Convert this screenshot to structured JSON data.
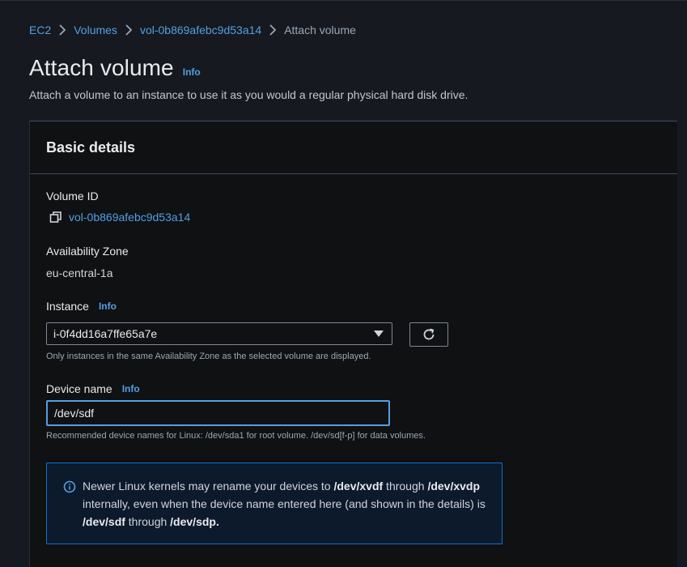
{
  "breadcrumb": {
    "items": [
      "EC2",
      "Volumes",
      "vol-0b869afebc9d53a14"
    ],
    "current": "Attach volume"
  },
  "header": {
    "title": "Attach volume",
    "info": "Info",
    "description": "Attach a volume to an instance to use it as you would a regular physical hard disk drive."
  },
  "basic_details": {
    "title": "Basic details",
    "volume_id_label": "Volume ID",
    "volume_id": "vol-0b869afebc9d53a14",
    "az_label": "Availability Zone",
    "az_value": "eu-central-1a",
    "instance_label": "Instance",
    "instance_info": "Info",
    "instance_value": "i-0f4dd16a7ffe65a7e",
    "instance_hint": "Only instances in the same Availability Zone as the selected volume are displayed.",
    "device_label": "Device name",
    "device_info": "Info",
    "device_value": "/dev/sdf",
    "device_hint": "Recommended device names for Linux: /dev/sda1 for root volume. /dev/sd[f-p] for data volumes."
  },
  "alert": {
    "t1": "Newer Linux kernels may rename your devices to ",
    "b1": "/dev/xvdf",
    "t2": " through ",
    "b2": "/dev/xvdp",
    "t3": " internally, even when the device name entered here (and shown in the details) is ",
    "b3": "/dev/sdf",
    "t4": " through ",
    "b4": "/dev/sdp."
  },
  "icons": {
    "breadcrumb_separator": "chevron-right-icon",
    "copy": "copy-icon",
    "dropdown": "caret-down-icon",
    "refresh": "refresh-icon",
    "alert": "info-circle-icon"
  },
  "colors": {
    "link": "#539fe5",
    "alert_border": "#0972d3",
    "focus": "#539fe5"
  }
}
